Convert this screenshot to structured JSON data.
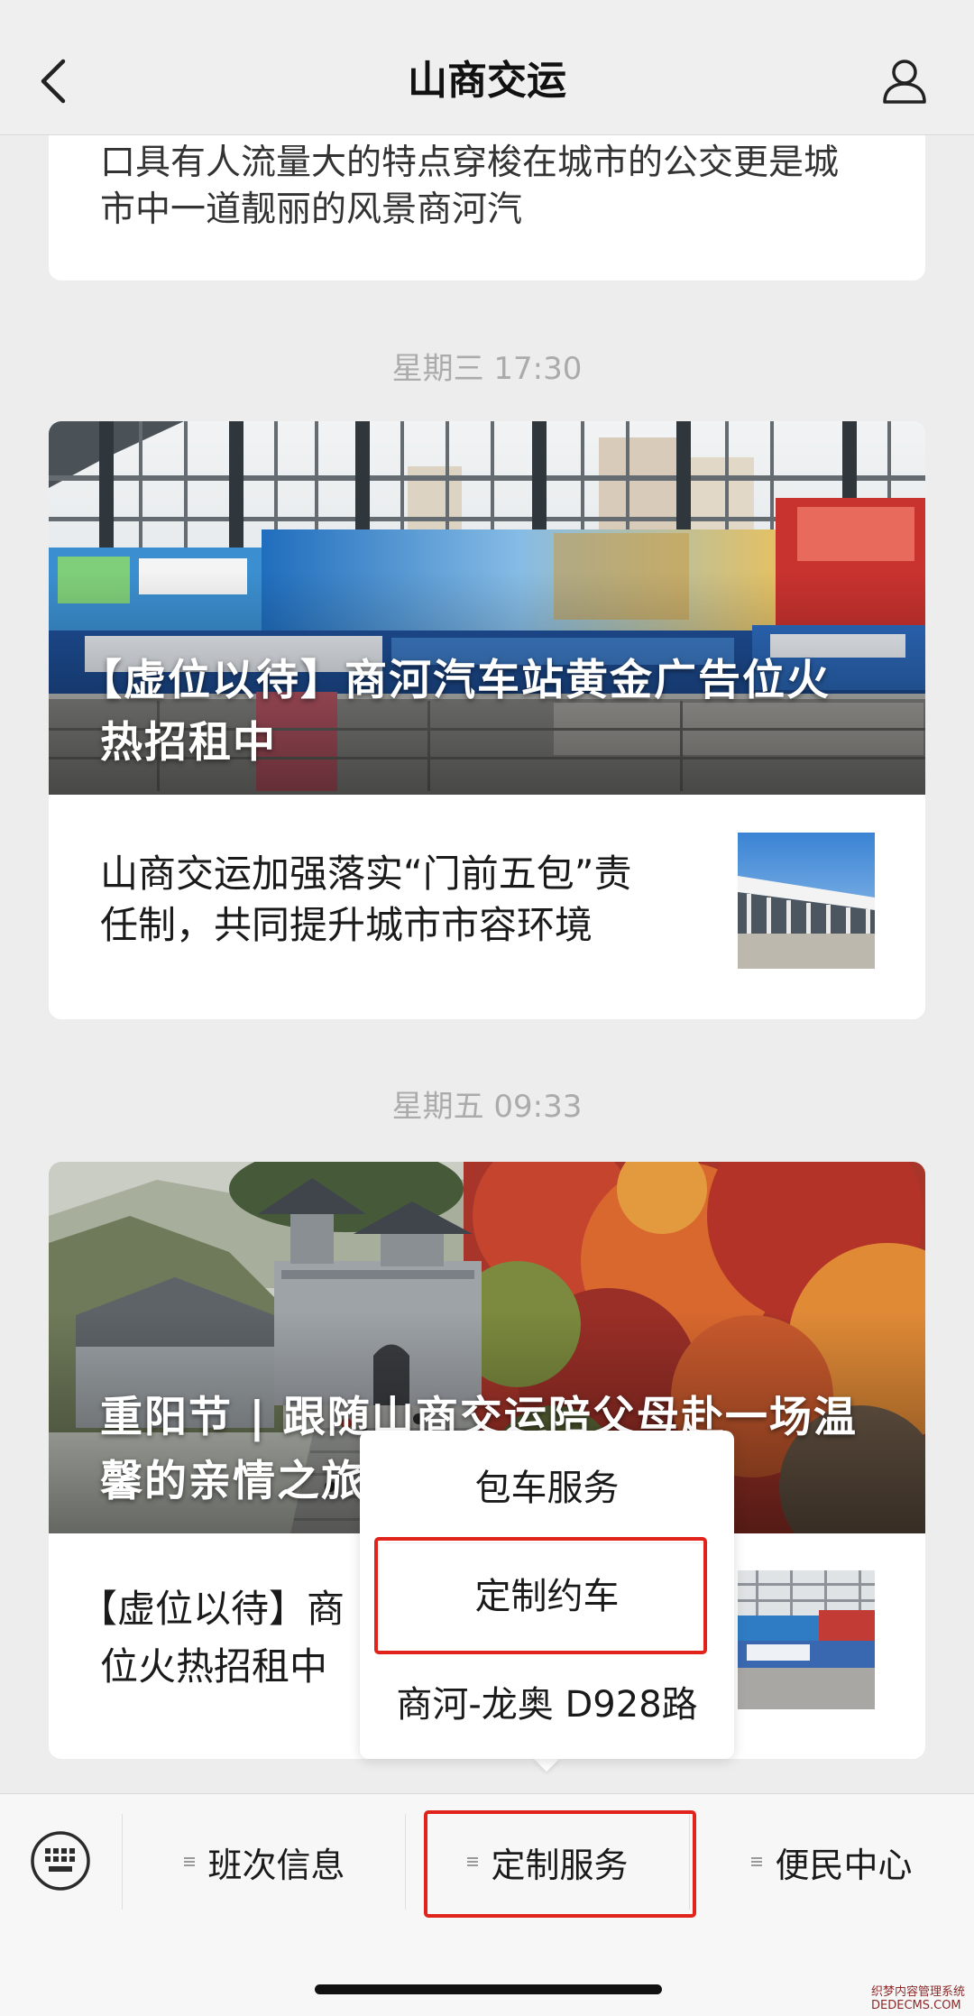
{
  "header": {
    "title": "山商交运",
    "back_icon": "chevron-left-icon",
    "profile_icon": "person-icon"
  },
  "feed": {
    "partial_card": {
      "lines": [
        "口具有人流量大的特点穿梭在城市的公交更是城",
        "市中一道靓丽的风景商河汽"
      ]
    },
    "groups": [
      {
        "timestamp": "星期三 17:30",
        "hero_title_lines": [
          "【虚位以待】商河汽车站黄金广告位火",
          "热招租中"
        ],
        "items": [
          {
            "title_lines": [
              "山商交运加强落实“门前五包”责",
              "任制，共同提升城市市容环境"
            ]
          }
        ]
      },
      {
        "timestamp": "星期五 09:33",
        "hero_title_lines": [
          "重阳节 | 跟随山商交运陪父母赴一场温",
          "馨的亲情之旅"
        ],
        "items": [
          {
            "title_lines": [
              "【虚位以待】商",
              "位火热招租中"
            ]
          }
        ]
      }
    ]
  },
  "popup_menu": {
    "items": [
      {
        "label": "包车服务",
        "annotated": false
      },
      {
        "label": "定制约车",
        "annotated": true
      },
      {
        "label": "商河-龙奥 D928路",
        "annotated": false
      }
    ]
  },
  "bottom_menu": {
    "keyboard_icon": "keyboard-icon",
    "item_icon": "menu-lines-icon",
    "items": [
      {
        "label": "班次信息",
        "annotated": false
      },
      {
        "label": "定制服务",
        "annotated": true
      },
      {
        "label": "便民中心",
        "annotated": false
      }
    ]
  },
  "watermark": [
    "织梦内容管理系统",
    "DEDECMS.COM"
  ],
  "colors": {
    "background": "#ededed",
    "card": "#ffffff",
    "timestamp": "#ababab",
    "annotation_red": "#e0241b"
  }
}
